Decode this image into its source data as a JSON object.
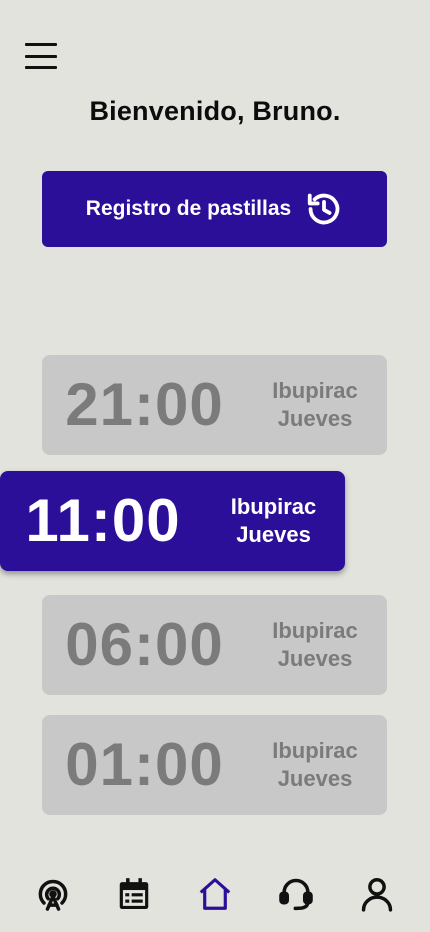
{
  "header": {
    "menu_icon": "hamburger-icon",
    "greeting": "Bienvenido, Bruno."
  },
  "registro": {
    "label": "Registro de pastillas",
    "icon": "history-icon"
  },
  "schedule": [
    {
      "time": "21:00",
      "medicine": "Ibupirac",
      "day": "Jueves",
      "active": false
    },
    {
      "time": "11:00",
      "medicine": "Ibupirac",
      "day": "Jueves",
      "active": true
    },
    {
      "time": "06:00",
      "medicine": "Ibupirac",
      "day": "Jueves",
      "active": false
    },
    {
      "time": "01:00",
      "medicine": "Ibupirac",
      "day": "Jueves",
      "active": false
    }
  ],
  "nav": {
    "items": [
      "broadcast-icon",
      "calendar-icon",
      "home-icon",
      "support-headset-icon",
      "profile-icon"
    ],
    "active": "home-icon"
  },
  "colors": {
    "accent": "#2c0f98",
    "background": "#e2e3dc",
    "card_inactive": "#c8c8c8",
    "text_inactive": "#7b7b7b"
  }
}
